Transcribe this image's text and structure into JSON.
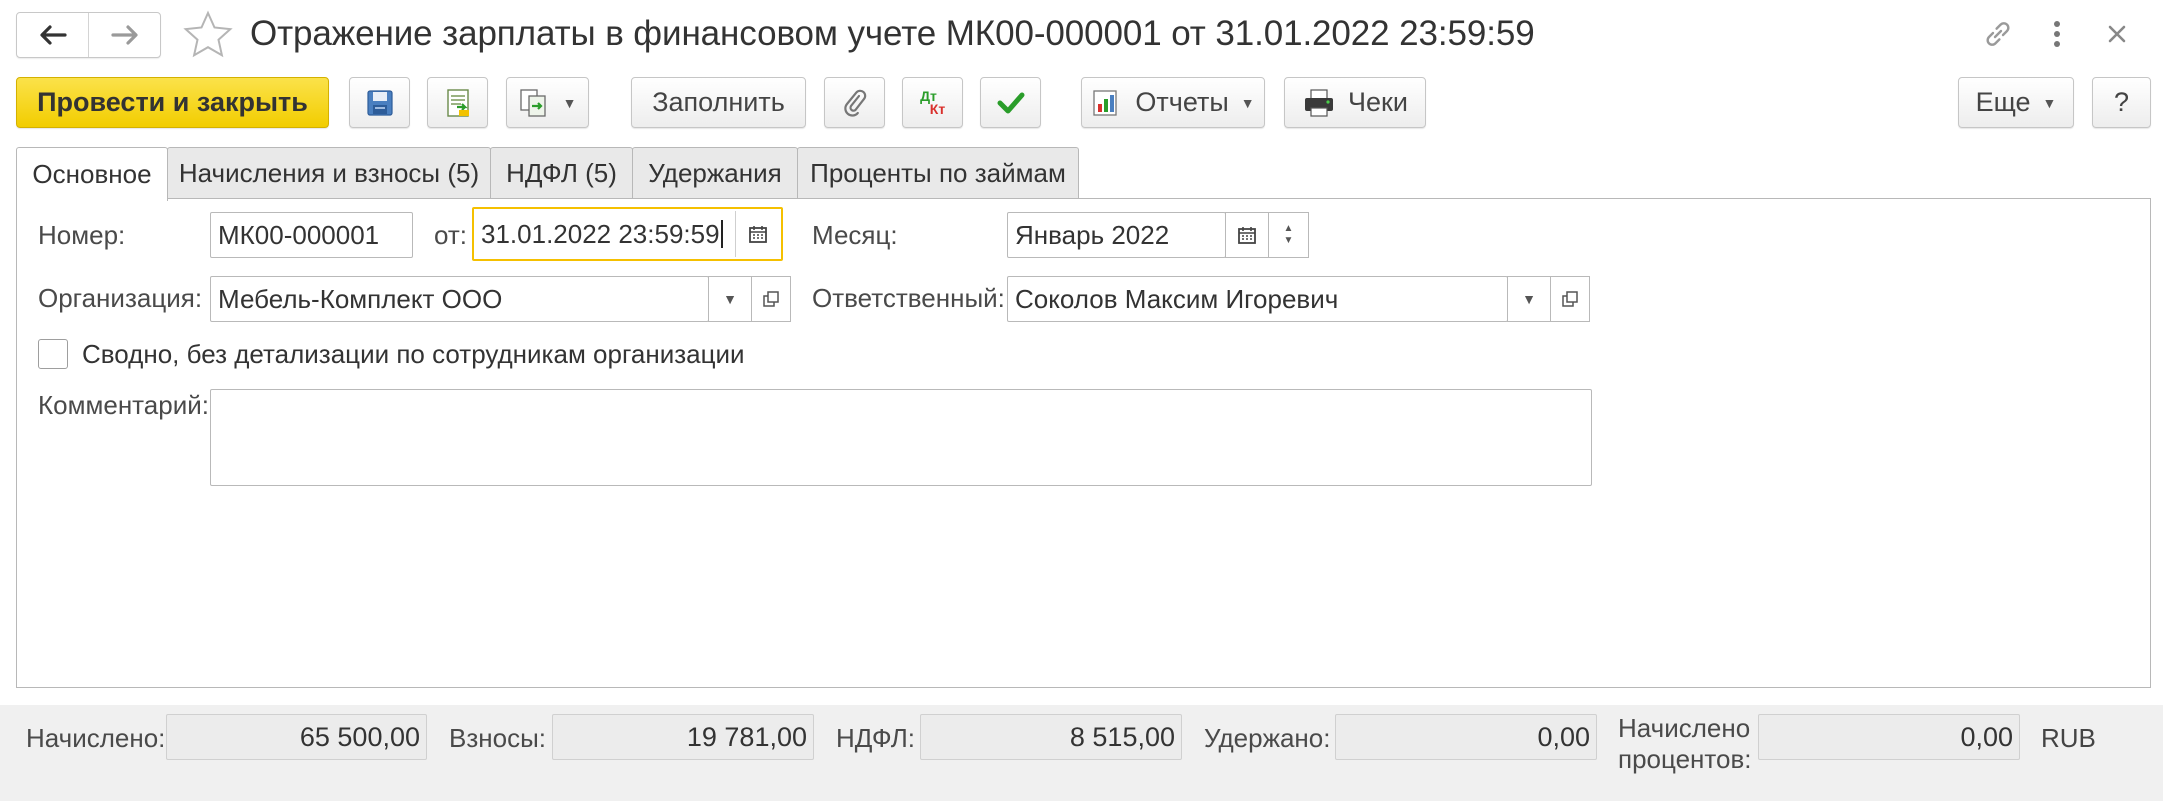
{
  "window": {
    "title": "Отражение зарплаты в финансовом учете МК00-000001 от 31.01.2022 23:59:59",
    "icons": [
      "back-arrow-icon",
      "forward-arrow-icon",
      "star-icon",
      "link-icon",
      "more-vert-icon",
      "close-icon"
    ]
  },
  "toolbar": {
    "post_close_label": "Провести и закрыть",
    "fill_label": "Заполнить",
    "reports_label": "Отчеты",
    "receipts_label": "Чеки",
    "more_label": "Еще",
    "help_label": "?",
    "dt_label": "Дт",
    "kt_label": "Кт",
    "icons": [
      "save-icon",
      "post-icon",
      "create-based-icon",
      "attach-icon",
      "dt-kt-icon",
      "check-icon",
      "reports-icon",
      "printer-icon"
    ]
  },
  "tabs": [
    {
      "label": "Основное",
      "active": true
    },
    {
      "label": "Начисления и взносы (5)",
      "active": false
    },
    {
      "label": "НДФЛ (5)",
      "active": false
    },
    {
      "label": "Удержания",
      "active": false
    },
    {
      "label": "Проценты по займам",
      "active": false
    }
  ],
  "form": {
    "number_label": "Номер:",
    "number_value": "МК00-000001",
    "date_label": "от:",
    "date_value": "31.01.2022 23:59:59",
    "month_label": "Месяц:",
    "month_value": "Январь 2022",
    "org_label": "Организация:",
    "org_value": "Мебель-Комплект ООО",
    "responsible_label": "Ответственный:",
    "responsible_value": "Соколов Максим Игоревич",
    "summary_checkbox_label": "Сводно, без детализации по сотрудникам организации",
    "summary_checked": false,
    "comment_label": "Комментарий:",
    "comment_value": ""
  },
  "footer": {
    "accrued_label": "Начислено:",
    "accrued_value": "65 500,00",
    "contrib_label": "Взносы:",
    "contrib_value": "19 781,00",
    "ndfl_label": "НДФЛ:",
    "ndfl_value": "8 515,00",
    "withheld_label": "Удержано:",
    "withheld_value": "0,00",
    "interest_label_1": "Начислено",
    "interest_label_2": "процентов:",
    "interest_value": "0,00",
    "currency": "RUB"
  },
  "colors": {
    "primary_button": "#f5d21a",
    "focus_border": "#f5c000",
    "check_green": "#2a9d2a"
  }
}
